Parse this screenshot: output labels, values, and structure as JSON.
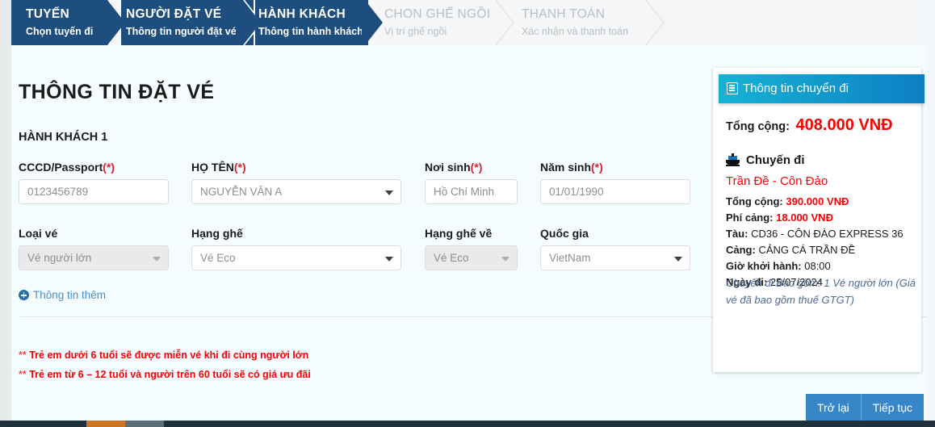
{
  "stepper": {
    "steps": [
      {
        "title": "TUYẾN",
        "sub": "Chọn tuyến đi",
        "state": "active"
      },
      {
        "title": "NGƯỜI ĐẶT VÉ",
        "sub": "Thông tin người đặt vé",
        "state": "active"
      },
      {
        "title": "HÀNH KHÁCH",
        "sub": "Thông tin hành khách",
        "state": "active"
      },
      {
        "title": "CHON GHẾ NGỒI",
        "sub": "Vị trí ghế ngồi",
        "state": "inactive"
      },
      {
        "title": "THANH TOÁN",
        "sub": "Xác nhận và thanh toán",
        "state": "inactive"
      }
    ],
    "active_color": "#1d4e7e",
    "inactive_color": "#b9bfc4",
    "track_color": "#f4f6f7"
  },
  "main": {
    "page_title": "THÔNG TIN ĐẶT VÉ",
    "passenger_heading": "HÀNH KHÁCH 1",
    "fields": {
      "id": {
        "label": "CCCD/Passport",
        "required": "(*)",
        "value": "0123456789",
        "type": "text"
      },
      "name": {
        "label": "HỌ TÊN",
        "required": "(*)",
        "value": "NGUYỄN VĂN A",
        "type": "select"
      },
      "birthplace": {
        "label": "Nơi sinh",
        "required": "(*)",
        "value": "Hồ Chí Minh",
        "type": "text"
      },
      "birthyear": {
        "label": "Năm sinh",
        "required": "(*)",
        "value": "01/01/1990",
        "type": "text"
      },
      "ticket_type": {
        "label": "Loại vé",
        "required": "",
        "value": "Vé người lớn",
        "type": "select-disabled"
      },
      "seat_class": {
        "label": "Hạng ghế",
        "required": "",
        "value": "Vé Eco",
        "type": "select"
      },
      "seat_class_return": {
        "label": "Hạng ghế về",
        "required": "",
        "value": "Vé Eco",
        "type": "select-disabled"
      },
      "country": {
        "label": "Quốc gia",
        "required": "",
        "value": "VietNam",
        "type": "select"
      }
    },
    "more_info_label": "Thông tin thêm",
    "notes": [
      {
        "stars": "**",
        "text": "Trẻ em dưới 6 tuổi sẽ được miễn vé khi đi cùng người lớn"
      },
      {
        "stars": "**",
        "text": "Trẻ em từ 6 – 12 tuổi và người trên 60 tuổi sẽ có giá ưu đãi"
      }
    ],
    "note_color": "#fb0000"
  },
  "sidebar": {
    "header_title": "Thông tin chuyển đi",
    "total_label": "Tổng cộng:",
    "total_value": "408.000 VNĐ",
    "trip_heading": "Chuyến đi",
    "route": "Trần Đề - Côn Đảo",
    "details": [
      {
        "key": "Tổng cộng:",
        "value": "390.000 VNĐ",
        "value_style": "red"
      },
      {
        "key": "Phí cảng:",
        "value": "18.000 VNĐ",
        "value_style": "red"
      },
      {
        "key": "Tàu:",
        "value": "CD36 - CÔN ĐÀO EXPRESS 36",
        "value_style": "plain"
      },
      {
        "key": "Cảng:",
        "value": "CẢNG CÁ TRẦN ĐỀ",
        "value_style": "plain"
      },
      {
        "key": "Giờ khởi hành:",
        "value": "08:00",
        "value_style": "plain"
      },
      {
        "key": "Ngày đi:",
        "value": "25/07/2024",
        "value_style": "plain"
      }
    ],
    "included": "Chuyến đi Bao gồm: 1 Vé người lớn (Giá vé đã bao gồm thuế GTGT)",
    "header_gradient_from": "#16b3d4",
    "header_gradient_to": "#0d7fc4",
    "price_color": "#fb0000"
  },
  "footer": {
    "back_label": "Trở lại",
    "continue_label": "Tiếp tục",
    "button_color": "#3787c8"
  }
}
